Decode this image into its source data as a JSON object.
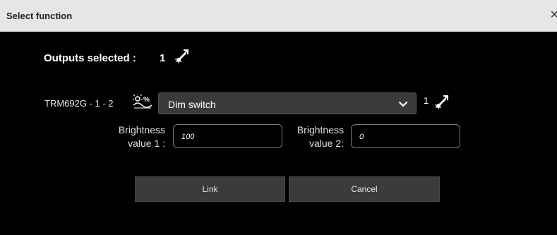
{
  "dialog": {
    "title": "Select function",
    "close_glyph": "×"
  },
  "outputs": {
    "label": "Outputs selected :",
    "count": "1"
  },
  "row": {
    "device": "TRM692G - 1 - 2",
    "function_value": "Dim switch",
    "count": "1"
  },
  "brightness": {
    "label1_line1": "Brightness",
    "label1_line2": "value 1 :",
    "value1": "100",
    "label2_line1": "Brightness",
    "label2_line2": "value 2:",
    "value2": "0"
  },
  "buttons": {
    "link": "Link",
    "cancel": "Cancel"
  },
  "icons": {
    "output": "light-bulb-output-icon",
    "dim": "dim-percent-icon",
    "dropdown": "chevron-down-icon"
  },
  "colors": {
    "background": "#000000",
    "titlebar": "#e6e6e6",
    "button": "#3b3b3b",
    "select": "#3a3a3a"
  }
}
